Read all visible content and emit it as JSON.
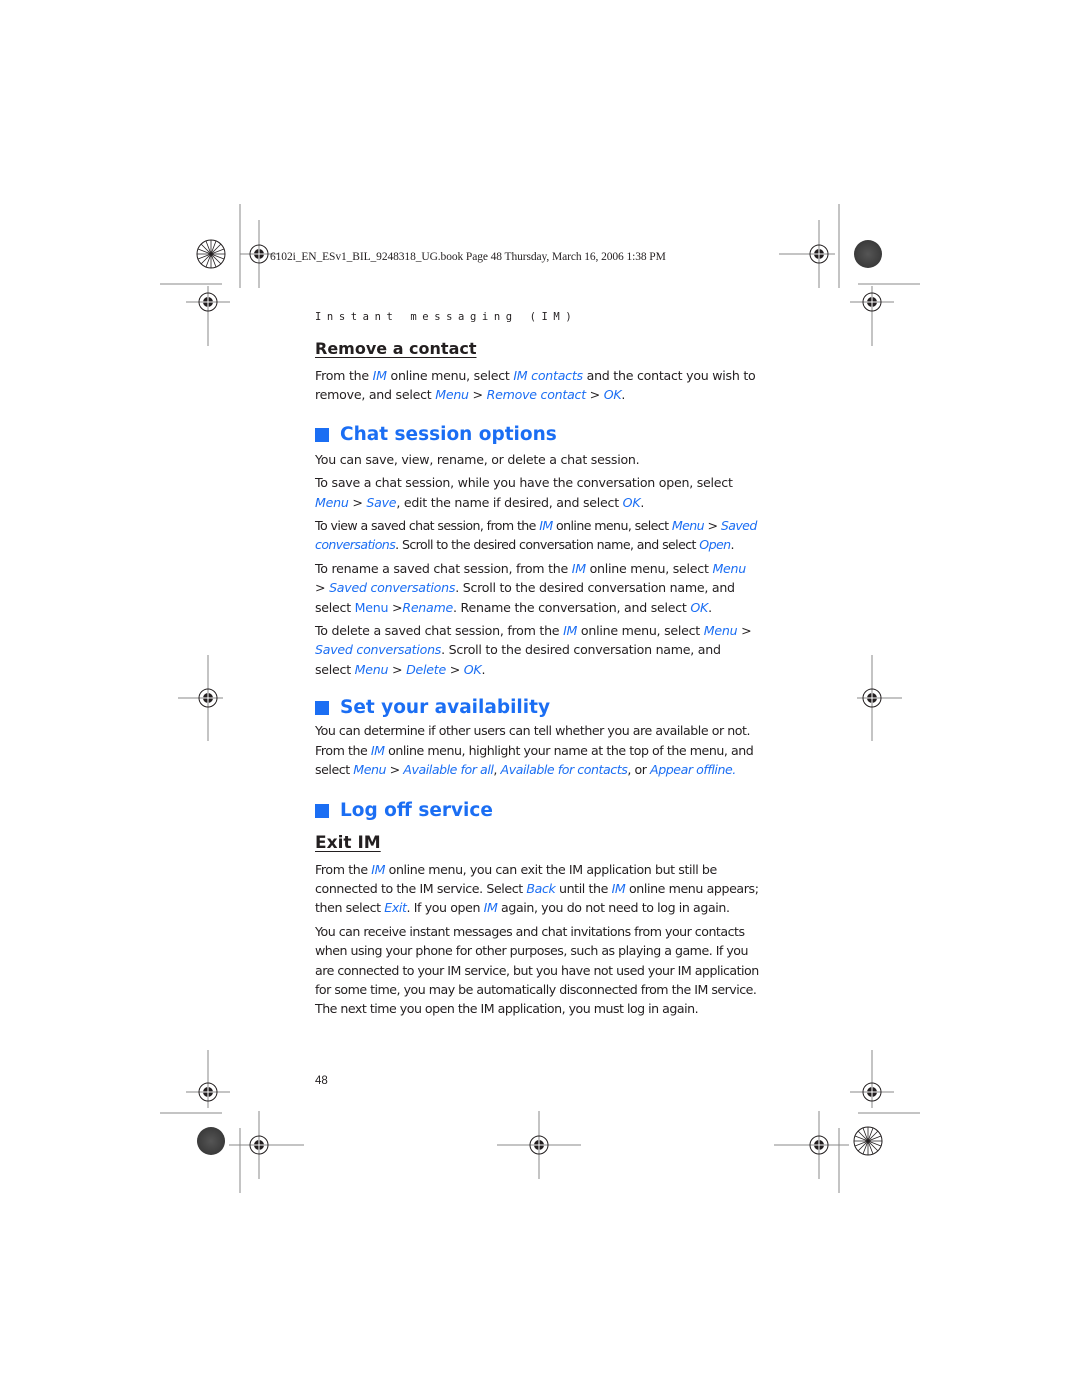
{
  "slug_line": "6102i_EN_ESv1_BIL_9248318_UG.book  Page 48  Thursday, March 16, 2006  1:38 PM",
  "running_head": "Instant messaging (IM)",
  "accent_color": "#1b6ef3",
  "page_number": "48",
  "remove_contact": {
    "title": "Remove a contact",
    "p1": {
      "t1": "From the ",
      "l1": "IM",
      "t2": " online menu, select ",
      "l2": "IM contacts",
      "t3": " and the contact you wish to remove, and select ",
      "l3": "Menu",
      "t4": " > ",
      "l4": "Remove contact",
      "t5": " > ",
      "l5": "OK",
      "t6": "."
    }
  },
  "chat_session": {
    "title": "Chat session options",
    "intro": "You can save, view, rename, or delete a chat session.",
    "save": {
      "t1": "To save a chat session, while you have the conversation open, select ",
      "l1": "Menu",
      "t2": " > ",
      "l2": "Save",
      "t3": ", edit the name if desired, and select ",
      "l3": "OK",
      "t4": "."
    },
    "view": {
      "t1": "To view a saved chat session, from the ",
      "l1": "IM",
      "t2": " online menu, select ",
      "l2": "Menu",
      "t3": " > ",
      "l3": "Saved conversations",
      "t4": ". Scroll to the desired conversation name, and select ",
      "l4": "Open",
      "t5": "."
    },
    "rename": {
      "t1": "To rename a saved chat session, from the ",
      "l1": "IM",
      "t2": " online menu, select ",
      "l2": "Menu",
      "t3": " > ",
      "l3": "Saved conversations",
      "t4": ". Scroll to the desired conversation name, and select ",
      "l4": "Menu",
      "t5": " >",
      "l5": "Rename",
      "t6": ". Rename the conversation, and select ",
      "l6": "OK",
      "t7": "."
    },
    "delete": {
      "t1": "To delete a saved chat session, from the ",
      "l1": "IM",
      "t2": " online menu, select ",
      "l2": "Menu",
      "t3": " > ",
      "l3": "Saved conversations",
      "t4": ". Scroll to the desired conversation name, and select ",
      "l4": "Menu",
      "t5": " > ",
      "l5": "Delete",
      "t6": " > ",
      "l6": "OK",
      "t7": "."
    }
  },
  "availability": {
    "title": "Set your availability",
    "p1": {
      "t1": "You can determine if other users can tell whether you are available or not. From the ",
      "l1": "IM",
      "t2": " online menu, highlight your name at the top of the menu, and select ",
      "l2": "Menu",
      "t3": " > ",
      "l3": "Available for all",
      "t4": ", ",
      "l4": "Available for contacts",
      "t5": ", or ",
      "l5": "Appear offline."
    }
  },
  "log_off": {
    "title": "Log off service",
    "exit_title": "Exit IM",
    "p1": {
      "t1": "From the ",
      "l1": "IM",
      "t2": " online menu, you can exit the IM application but still be connected to the IM service. Select ",
      "l2": "Back",
      "t3": " until the ",
      "l3": "IM",
      "t4": " online menu appears; then select ",
      "l4": "Exit",
      "t5": ". If you open ",
      "l5": "IM",
      "t6": " again, you do not need to log in again."
    },
    "p2": "You can receive instant messages and chat invitations from your contacts when using your phone for other purposes, such as playing a game. If you are connected to your IM service, but you have not used your IM application for some time, you may be automatically disconnected from the IM service. The next time you open the IM application, you must log in again."
  }
}
